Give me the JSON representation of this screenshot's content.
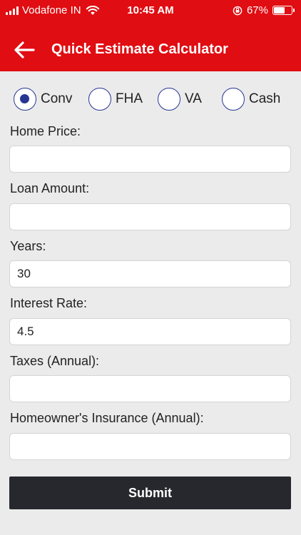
{
  "status_bar": {
    "carrier": "Vodafone IN",
    "time": "10:45 AM",
    "battery_percent": "67%",
    "battery_level": 0.67
  },
  "nav": {
    "title": "Quick Estimate Calculator",
    "back_icon": "arrow-left-icon"
  },
  "loan_types": [
    {
      "label": "Conv",
      "selected": true
    },
    {
      "label": "FHA",
      "selected": false
    },
    {
      "label": "VA",
      "selected": false
    },
    {
      "label": "Cash",
      "selected": false
    }
  ],
  "fields": {
    "home_price": {
      "label": "Home Price:",
      "value": ""
    },
    "loan_amount": {
      "label": "Loan Amount:",
      "value": ""
    },
    "years": {
      "label": "Years:",
      "value": "30"
    },
    "interest_rate": {
      "label": "Interest Rate:",
      "value": "4.5"
    },
    "taxes": {
      "label": "Taxes (Annual):",
      "value": ""
    },
    "insurance": {
      "label": "Homeowner's Insurance (Annual):",
      "value": ""
    }
  },
  "submit_label": "Submit",
  "colors": {
    "header": "#e00d12",
    "radio_accent": "#263592",
    "submit_bg": "#27282d",
    "background": "#ebebeb"
  }
}
